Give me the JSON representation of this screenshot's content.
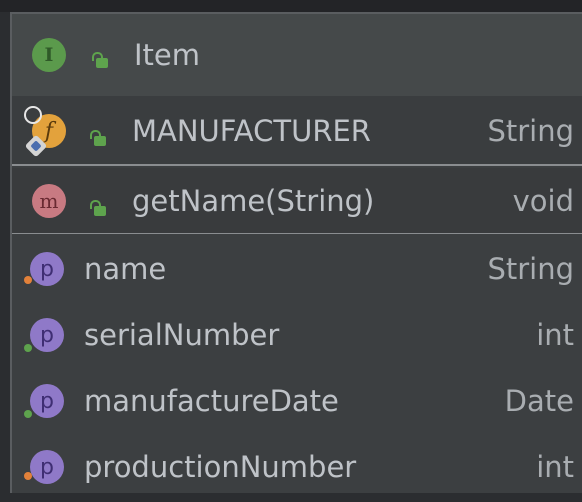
{
  "window": {
    "title": "Item"
  },
  "class_header": {
    "kind_icon": "interface-icon",
    "badge_letter": "I",
    "visibility_icon": "lock-icon",
    "name": "Item"
  },
  "field": {
    "badge_letter": "f",
    "name": "MANUFACTURER",
    "type": "String"
  },
  "method": {
    "badge_letter": "m",
    "name": "getName(String)",
    "type": "void"
  },
  "properties": [
    {
      "badge_letter": "p",
      "name": "name",
      "type": "String",
      "access_dot": "orange"
    },
    {
      "badge_letter": "p",
      "name": "serialNumber",
      "type": "int",
      "access_dot": "green"
    },
    {
      "badge_letter": "p",
      "name": "manufactureDate",
      "type": "Date",
      "access_dot": "green"
    },
    {
      "badge_letter": "p",
      "name": "productionNumber",
      "type": "int",
      "access_dot": "orange"
    }
  ],
  "colors": {
    "background": "#3c3f41",
    "header": "#45494a",
    "interface_badge": "#5b9a4c",
    "field_badge": "#e3a23c",
    "method_badge": "#c87a82",
    "property_badge": "#8f79c8",
    "lock": "#5ea34d"
  }
}
